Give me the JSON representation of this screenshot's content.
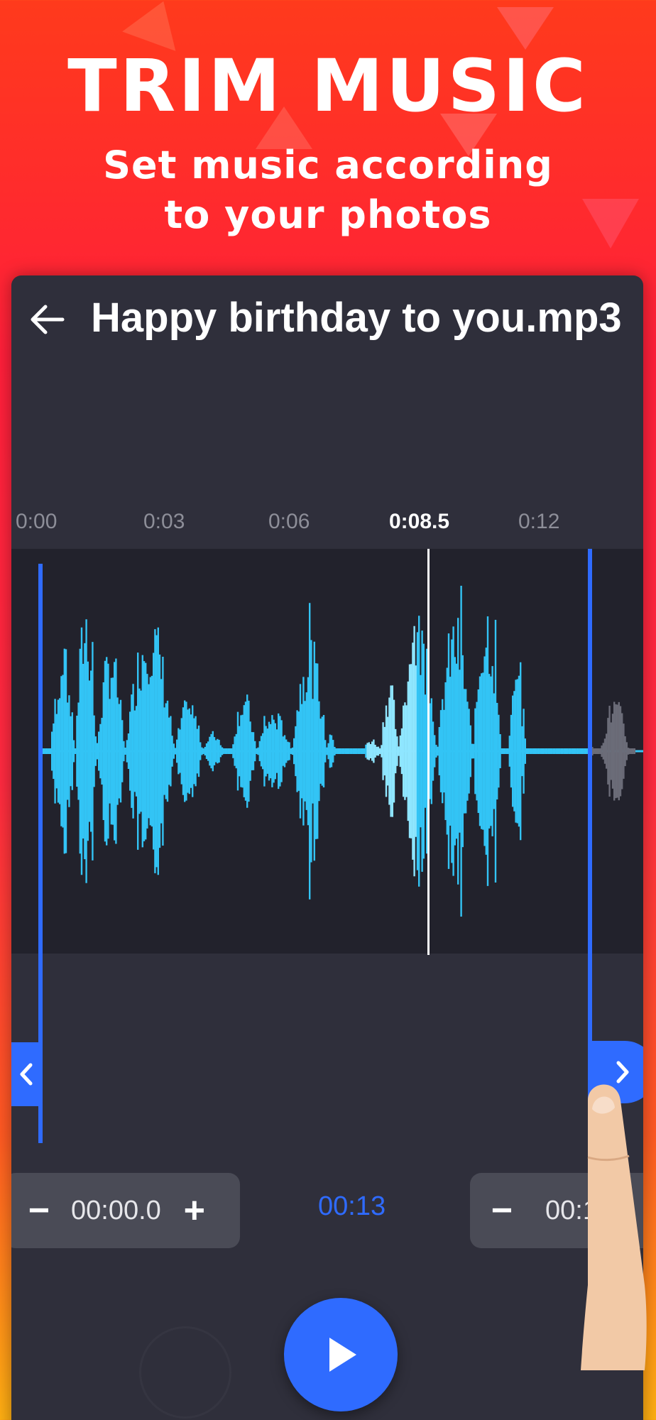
{
  "promo": {
    "title": "TRIM MUSIC",
    "subtitle_line1": "Set music according",
    "subtitle_line2": "to your photos"
  },
  "editor": {
    "file_name": "Happy birthday to you.mp3",
    "timeline": {
      "ticks": [
        "0:00",
        "0:03",
        "0:06",
        "0:08.5",
        "0:12"
      ],
      "current_time": "0:08.5"
    },
    "start_control": {
      "minus": "−",
      "value": "00:00.0",
      "plus": "+"
    },
    "duration": "00:13",
    "end_control": {
      "minus": "−",
      "value": "00:13"
    },
    "handles": {
      "left_icon": "chevron-left-icon",
      "right_icon": "chevron-right-icon"
    },
    "play_icon": "play-icon",
    "back_icon": "arrow-left-icon"
  },
  "colors": {
    "accent": "#2f6bff",
    "waveform": "#33c4f5",
    "waveform_highlight": "#8fe6ff",
    "panel": "#2f2f3b",
    "wave_bg": "#22222c"
  }
}
